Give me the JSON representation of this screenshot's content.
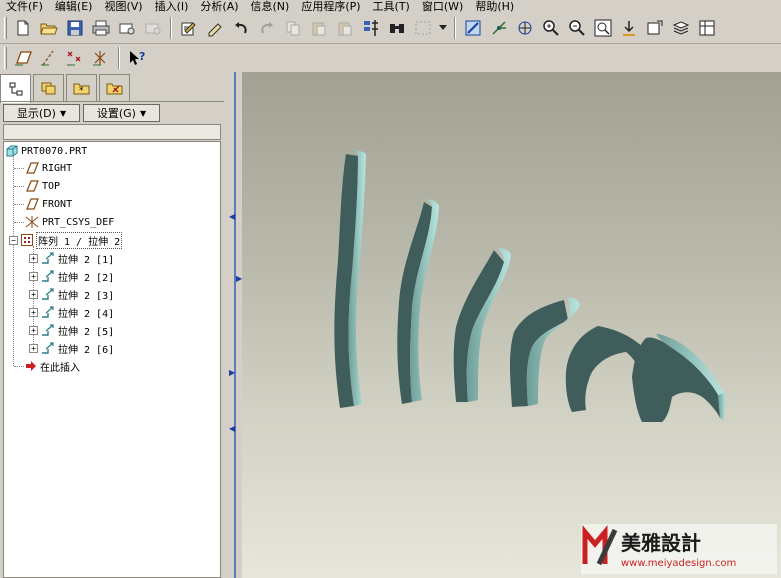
{
  "menu": [
    "文件(F)",
    "编辑(E)",
    "视图(V)",
    "插入(I)",
    "分析(A)",
    "信息(N)",
    "应用程序(P)",
    "工具(T)",
    "窗口(W)",
    "帮助(H)"
  ],
  "panel": {
    "display_label": "显示(D)",
    "settings_label": "设置(G)"
  },
  "tree": {
    "root": "PRT0070.PRT",
    "datums": [
      "RIGHT",
      "TOP",
      "FRONT",
      "PRT_CSYS_DEF"
    ],
    "pattern": "阵列 1 / 拉伸 2",
    "children": [
      "拉伸 2 [1]",
      "拉伸 2 [2]",
      "拉伸 2 [3]",
      "拉伸 2 [4]",
      "拉伸 2 [5]",
      "拉伸 2 [6]"
    ],
    "insert_here": "在此插入"
  },
  "logo": {
    "title": "美雅設計",
    "url": "www.meiyadesign.com"
  },
  "colors": {
    "model": "#3f5d5a",
    "model_highlight": "#a9d9d4",
    "selection_blue": "#1b3d9e",
    "logo_red": "#cc1f1f"
  }
}
